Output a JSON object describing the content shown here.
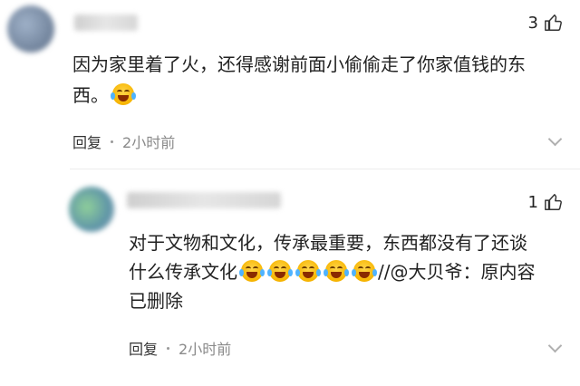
{
  "comments": [
    {
      "like_count": "3",
      "text_line1": "因为家里着了火，还得感谢前面小偷偷走了你家值钱的东",
      "text_line2": "西。",
      "emoji_count": 1,
      "reply_label": "回复",
      "time": "2小时前"
    },
    {
      "like_count": "1",
      "text_line1": "对于文物和文化，传承最重要，东西都没有了还谈",
      "text_line2_before": "什么传承文化",
      "emoji_count": 5,
      "text_line2_after": "//@大贝爷：原内容",
      "text_line3": "已删除",
      "reply_label": "回复",
      "time": "2小时前"
    }
  ],
  "icons": {
    "like": "thumbs-up-icon",
    "emoji": "laughing-tears-emoji-icon",
    "more": "chevron-down-icon"
  },
  "colors": {
    "text": "#222222",
    "meta": "#8a8a8a",
    "emoji": "#f7b500"
  }
}
